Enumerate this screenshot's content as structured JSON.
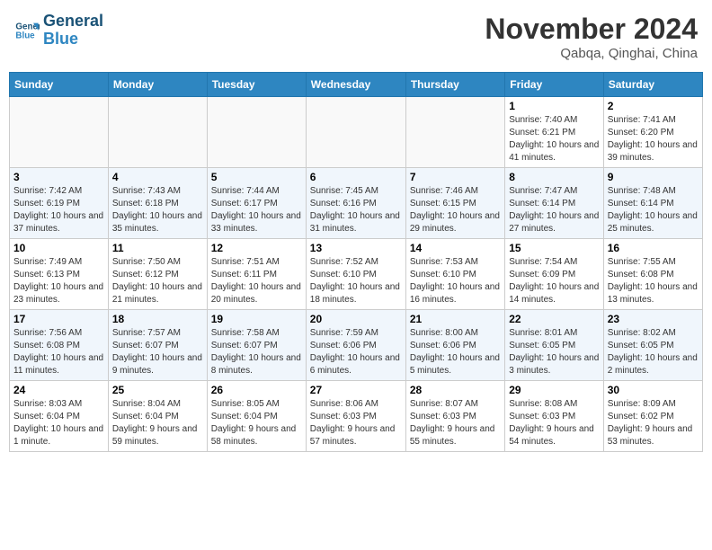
{
  "header": {
    "logo_line1": "General",
    "logo_line2": "Blue",
    "month": "November 2024",
    "location": "Qabqa, Qinghai, China"
  },
  "weekdays": [
    "Sunday",
    "Monday",
    "Tuesday",
    "Wednesday",
    "Thursday",
    "Friday",
    "Saturday"
  ],
  "weeks": [
    [
      {
        "day": "",
        "info": ""
      },
      {
        "day": "",
        "info": ""
      },
      {
        "day": "",
        "info": ""
      },
      {
        "day": "",
        "info": ""
      },
      {
        "day": "",
        "info": ""
      },
      {
        "day": "1",
        "info": "Sunrise: 7:40 AM\nSunset: 6:21 PM\nDaylight: 10 hours and 41 minutes."
      },
      {
        "day": "2",
        "info": "Sunrise: 7:41 AM\nSunset: 6:20 PM\nDaylight: 10 hours and 39 minutes."
      }
    ],
    [
      {
        "day": "3",
        "info": "Sunrise: 7:42 AM\nSunset: 6:19 PM\nDaylight: 10 hours and 37 minutes."
      },
      {
        "day": "4",
        "info": "Sunrise: 7:43 AM\nSunset: 6:18 PM\nDaylight: 10 hours and 35 minutes."
      },
      {
        "day": "5",
        "info": "Sunrise: 7:44 AM\nSunset: 6:17 PM\nDaylight: 10 hours and 33 minutes."
      },
      {
        "day": "6",
        "info": "Sunrise: 7:45 AM\nSunset: 6:16 PM\nDaylight: 10 hours and 31 minutes."
      },
      {
        "day": "7",
        "info": "Sunrise: 7:46 AM\nSunset: 6:15 PM\nDaylight: 10 hours and 29 minutes."
      },
      {
        "day": "8",
        "info": "Sunrise: 7:47 AM\nSunset: 6:14 PM\nDaylight: 10 hours and 27 minutes."
      },
      {
        "day": "9",
        "info": "Sunrise: 7:48 AM\nSunset: 6:14 PM\nDaylight: 10 hours and 25 minutes."
      }
    ],
    [
      {
        "day": "10",
        "info": "Sunrise: 7:49 AM\nSunset: 6:13 PM\nDaylight: 10 hours and 23 minutes."
      },
      {
        "day": "11",
        "info": "Sunrise: 7:50 AM\nSunset: 6:12 PM\nDaylight: 10 hours and 21 minutes."
      },
      {
        "day": "12",
        "info": "Sunrise: 7:51 AM\nSunset: 6:11 PM\nDaylight: 10 hours and 20 minutes."
      },
      {
        "day": "13",
        "info": "Sunrise: 7:52 AM\nSunset: 6:10 PM\nDaylight: 10 hours and 18 minutes."
      },
      {
        "day": "14",
        "info": "Sunrise: 7:53 AM\nSunset: 6:10 PM\nDaylight: 10 hours and 16 minutes."
      },
      {
        "day": "15",
        "info": "Sunrise: 7:54 AM\nSunset: 6:09 PM\nDaylight: 10 hours and 14 minutes."
      },
      {
        "day": "16",
        "info": "Sunrise: 7:55 AM\nSunset: 6:08 PM\nDaylight: 10 hours and 13 minutes."
      }
    ],
    [
      {
        "day": "17",
        "info": "Sunrise: 7:56 AM\nSunset: 6:08 PM\nDaylight: 10 hours and 11 minutes."
      },
      {
        "day": "18",
        "info": "Sunrise: 7:57 AM\nSunset: 6:07 PM\nDaylight: 10 hours and 9 minutes."
      },
      {
        "day": "19",
        "info": "Sunrise: 7:58 AM\nSunset: 6:07 PM\nDaylight: 10 hours and 8 minutes."
      },
      {
        "day": "20",
        "info": "Sunrise: 7:59 AM\nSunset: 6:06 PM\nDaylight: 10 hours and 6 minutes."
      },
      {
        "day": "21",
        "info": "Sunrise: 8:00 AM\nSunset: 6:06 PM\nDaylight: 10 hours and 5 minutes."
      },
      {
        "day": "22",
        "info": "Sunrise: 8:01 AM\nSunset: 6:05 PM\nDaylight: 10 hours and 3 minutes."
      },
      {
        "day": "23",
        "info": "Sunrise: 8:02 AM\nSunset: 6:05 PM\nDaylight: 10 hours and 2 minutes."
      }
    ],
    [
      {
        "day": "24",
        "info": "Sunrise: 8:03 AM\nSunset: 6:04 PM\nDaylight: 10 hours and 1 minute."
      },
      {
        "day": "25",
        "info": "Sunrise: 8:04 AM\nSunset: 6:04 PM\nDaylight: 9 hours and 59 minutes."
      },
      {
        "day": "26",
        "info": "Sunrise: 8:05 AM\nSunset: 6:04 PM\nDaylight: 9 hours and 58 minutes."
      },
      {
        "day": "27",
        "info": "Sunrise: 8:06 AM\nSunset: 6:03 PM\nDaylight: 9 hours and 57 minutes."
      },
      {
        "day": "28",
        "info": "Sunrise: 8:07 AM\nSunset: 6:03 PM\nDaylight: 9 hours and 55 minutes."
      },
      {
        "day": "29",
        "info": "Sunrise: 8:08 AM\nSunset: 6:03 PM\nDaylight: 9 hours and 54 minutes."
      },
      {
        "day": "30",
        "info": "Sunrise: 8:09 AM\nSunset: 6:02 PM\nDaylight: 9 hours and 53 minutes."
      }
    ]
  ]
}
